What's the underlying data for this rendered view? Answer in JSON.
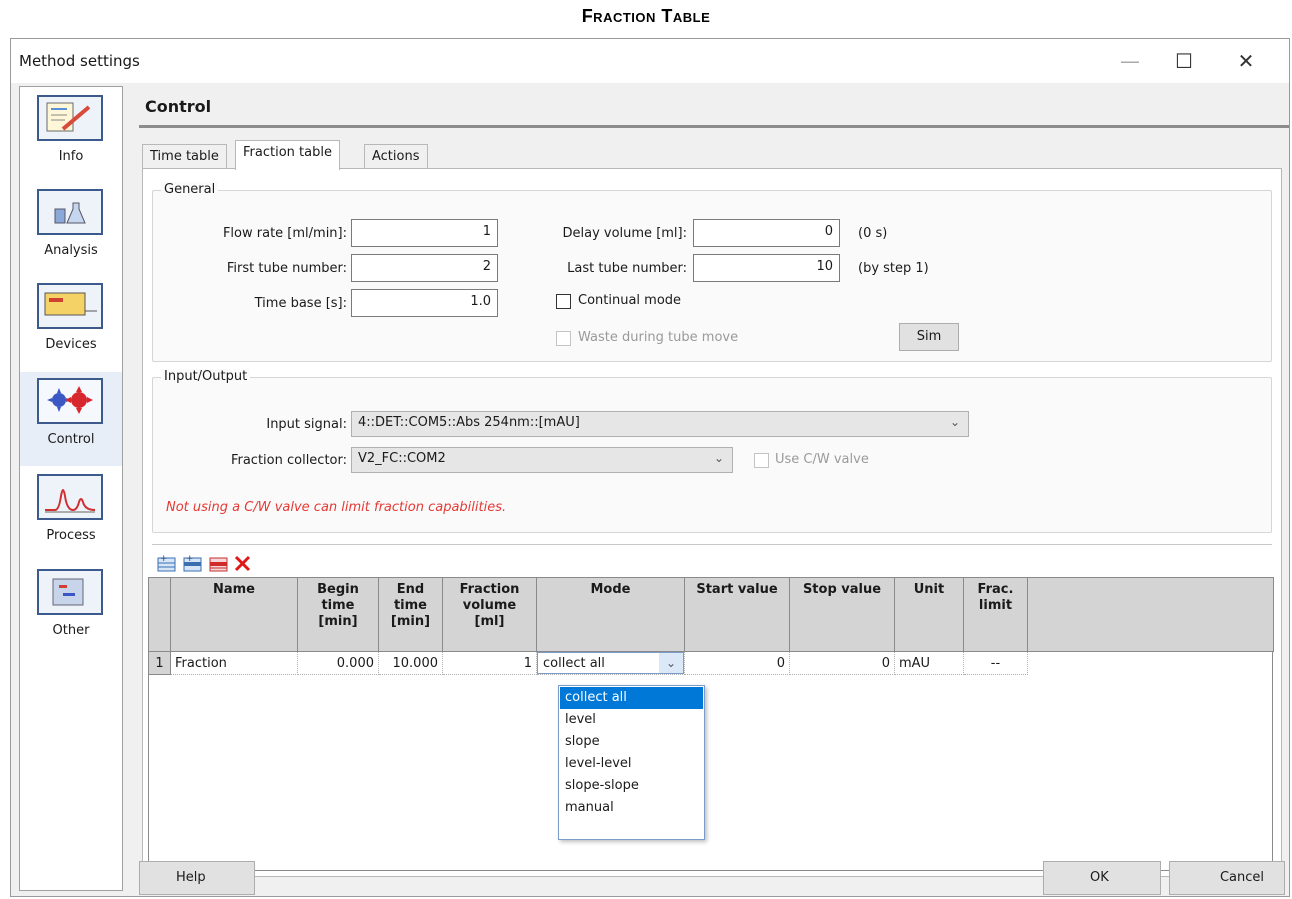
{
  "document_title": "Fraction Table",
  "window": {
    "title": "Method settings",
    "minimize": "—",
    "maximize": "☐",
    "close": "✕"
  },
  "sidebar": {
    "items": [
      {
        "label": "Info",
        "icon": "info-icon"
      },
      {
        "label": "Analysis",
        "icon": "analysis-icon"
      },
      {
        "label": "Devices",
        "icon": "devices-icon"
      },
      {
        "label": "Control",
        "icon": "control-icon",
        "active": true
      },
      {
        "label": "Process",
        "icon": "process-icon"
      },
      {
        "label": "Other",
        "icon": "other-icon"
      }
    ]
  },
  "section_title": "Control",
  "tabs": [
    {
      "label": "Time table"
    },
    {
      "label": "Fraction table",
      "active": true
    },
    {
      "label": "Actions"
    }
  ],
  "general": {
    "label": "General",
    "flow_rate_label": "Flow rate [ml/min]:",
    "flow_rate": "1",
    "first_tube_label": "First tube number:",
    "first_tube": "2",
    "time_base_label": "Time base [s]:",
    "time_base": "1.0",
    "delay_volume_label": "Delay volume [ml]:",
    "delay_volume": "0",
    "delay_note": "(0 s)",
    "last_tube_label": "Last tube number:",
    "last_tube": "10",
    "step_note": "(by step 1)",
    "continual_mode_label": "Continual mode",
    "continual_mode_checked": false,
    "waste_label": "Waste during tube move",
    "waste_checked": false,
    "sim_label": "Sim"
  },
  "io": {
    "label": "Input/Output",
    "input_signal_label": "Input signal:",
    "input_signal": "4::DET::COM5::Abs 254nm::[mAU]",
    "collector_label": "Fraction collector:",
    "collector": "V2_FC::COM2",
    "cw_valve_label": "Use C/W valve",
    "cw_valve_checked": false,
    "warning": "Not using a C/W valve can limit fraction capabilities."
  },
  "toolbar_icons": [
    "add-row-icon",
    "insert-row-icon",
    "delete-row-icon",
    "clear-icon"
  ],
  "table": {
    "headers": {
      "name": "Name",
      "begin_1": "Begin",
      "begin_2": "time",
      "begin_3": "[min]",
      "end_1": "End",
      "end_2": "time",
      "end_3": "[min]",
      "frac_1": "Fraction",
      "frac_2": "volume",
      "frac_3": "[ml]",
      "mode": "Mode",
      "start": "Start value",
      "stop": "Stop value",
      "unit": "Unit",
      "limit_1": "Frac.",
      "limit_2": "limit"
    },
    "rows": [
      {
        "index": "1",
        "name": "Fraction",
        "begin": "0.000",
        "end": "10.000",
        "volume": "1",
        "mode": "collect all",
        "start": "0",
        "stop": "0",
        "unit": "mAU",
        "limit": "--"
      }
    ]
  },
  "mode_options": [
    "collect all",
    "level",
    "slope",
    "level-level",
    "slope-slope",
    "manual"
  ],
  "footer": {
    "help": "Help",
    "ok": "OK",
    "cancel": "Cancel"
  }
}
